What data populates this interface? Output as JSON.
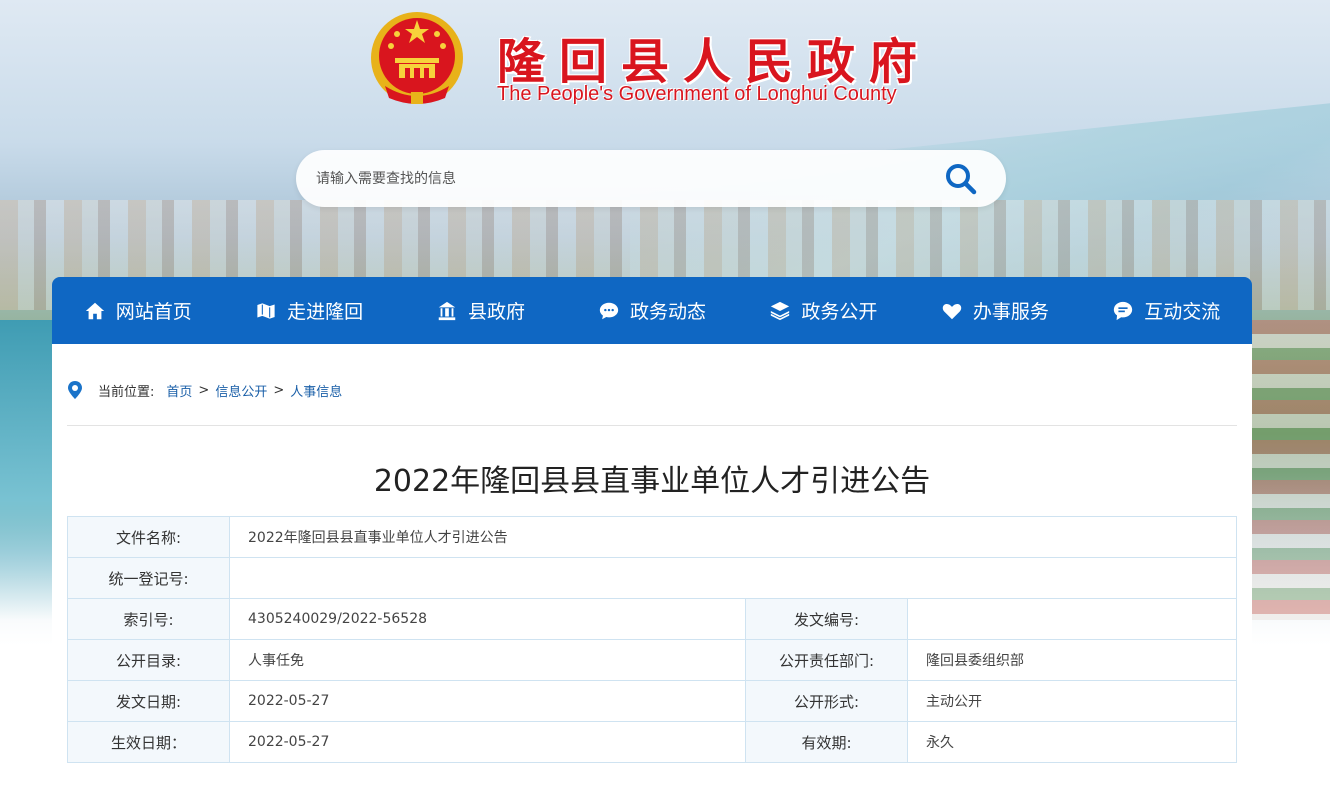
{
  "header": {
    "title": "隆回县人民政府",
    "subtitle": "The People's Government of Longhui County"
  },
  "search": {
    "placeholder": "请输入需要查找的信息"
  },
  "nav": {
    "items": [
      {
        "label": "网站首页",
        "icon": "home-icon"
      },
      {
        "label": "走进隆回",
        "icon": "map-icon"
      },
      {
        "label": "县政府",
        "icon": "government-building-icon"
      },
      {
        "label": "政务动态",
        "icon": "chat-bubbles-icon"
      },
      {
        "label": "政务公开",
        "icon": "layers-icon"
      },
      {
        "label": "办事服务",
        "icon": "heart-icon"
      },
      {
        "label": "互动交流",
        "icon": "message-icon"
      }
    ]
  },
  "breadcrumb": {
    "prefix": "当前位置:",
    "items": [
      "首页",
      "信息公开",
      "人事信息"
    ],
    "separator": ">"
  },
  "article": {
    "title": "2022年隆回县县直事业单位人才引进公告"
  },
  "meta": {
    "file_name_label": "文件名称:",
    "file_name": "2022年隆回县县直事业单位人才引进公告",
    "reg_no_label": "统一登记号:",
    "reg_no": "",
    "index_no_label": "索引号:",
    "index_no": "4305240029/2022-56528",
    "doc_no_label": "发文编号:",
    "doc_no": "",
    "catalog_label": "公开目录:",
    "catalog": "人事任免",
    "dept_label": "公开责任部门:",
    "dept": "隆回县委组织部",
    "issue_date_label": "发文日期:",
    "issue_date": "2022-05-27",
    "form_label": "公开形式:",
    "form": "主动公开",
    "effective_date_label": "生效日期：",
    "effective_date": "2022-05-27",
    "validity_label": "有效期:",
    "validity": "永久"
  },
  "colors": {
    "nav_bg": "#0f67c3",
    "title_red": "#d9151e",
    "link_blue": "#1a5fa8",
    "table_border": "#cfe3f1"
  }
}
